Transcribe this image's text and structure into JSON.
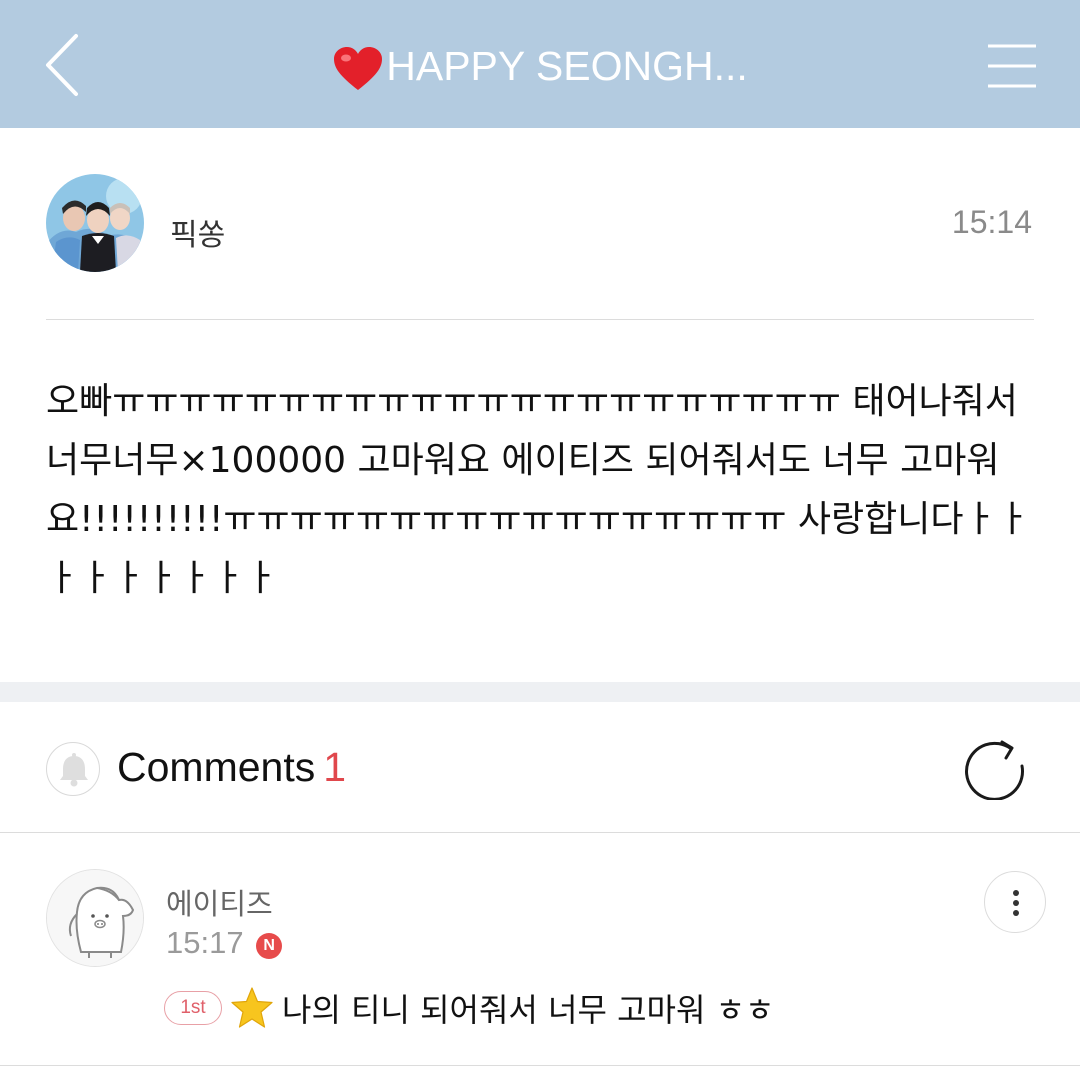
{
  "header": {
    "title": "HAPPY SEONGH...",
    "bg_color": "#b3cbe0"
  },
  "post": {
    "author": "픽쏭",
    "time": "15:14",
    "body": "오빠ㅠㅠㅠㅠㅠㅠㅠㅠㅠㅠㅠㅠㅠㅠㅠㅠㅠㅠㅠㅠㅠㅠ 태어나줘서 너무너무×100000 고마워요 에이티즈 되어줘서도 너무 고마워요!!!!!!!!!!ㅠㅠㅠㅠㅠㅠㅠㅠㅠㅠㅠㅠㅠㅠㅠㅠㅠ 사랑합니다ㅏㅏㅏㅏㅏㅏㅏㅏㅏ"
  },
  "comments": {
    "label": "Comments",
    "count": "1",
    "count_color": "#e0474c",
    "items": [
      {
        "author": "에이티즈",
        "time": "15:17",
        "new_badge": "N",
        "rank_badge": "1st",
        "text": "나의 티니 되어줘서 너무 고마워 ㅎㅎ"
      }
    ]
  },
  "icons": [
    "back-arrow-icon",
    "heart-icon",
    "menu-icon",
    "bell-icon",
    "refresh-icon",
    "more-vertical-icon",
    "star-icon"
  ]
}
